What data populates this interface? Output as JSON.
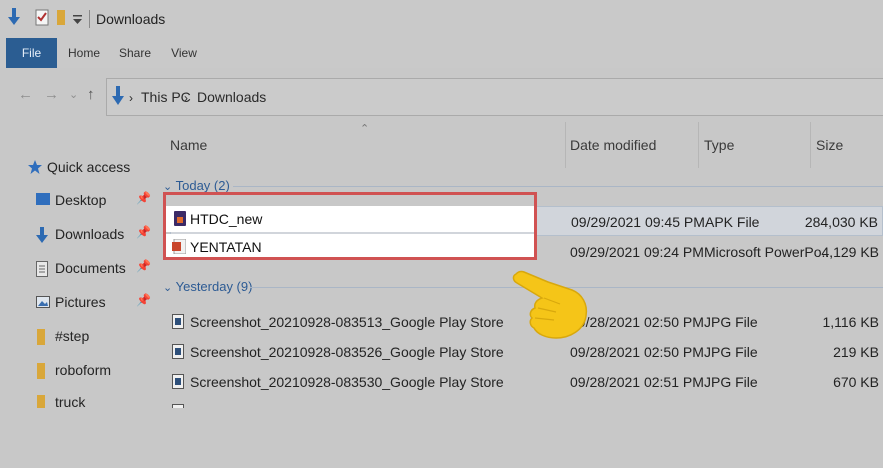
{
  "window": {
    "title": "Downloads"
  },
  "ribbon": {
    "tabs": [
      "File",
      "Home",
      "Share",
      "View"
    ]
  },
  "address": {
    "crumbs": [
      "This PC",
      "Downloads"
    ]
  },
  "sidebar": {
    "quick_access": "Quick access",
    "items": [
      {
        "label": "Desktop",
        "icon": "desktop-icon",
        "pinned": true
      },
      {
        "label": "Downloads",
        "icon": "download-arrow-icon",
        "pinned": true
      },
      {
        "label": "Documents",
        "icon": "documents-icon",
        "pinned": true
      },
      {
        "label": "Pictures",
        "icon": "pictures-icon",
        "pinned": true
      },
      {
        "label": "#step",
        "icon": "folder-icon",
        "pinned": false
      },
      {
        "label": "roboform",
        "icon": "folder-icon",
        "pinned": false
      },
      {
        "label": "truck",
        "icon": "folder-icon",
        "pinned": false
      }
    ]
  },
  "columns": {
    "name": "Name",
    "date": "Date modified",
    "type": "Type",
    "size": "Size"
  },
  "groups": {
    "today": {
      "label": "Today (2)",
      "files": [
        {
          "name": "HTDC_new",
          "date": "09/29/2021 09:45 PM",
          "type": "APK File",
          "size": "284,030 KB",
          "icon": "apk-file-icon"
        },
        {
          "name": "YENTATAN",
          "date": "09/29/2021 09:24 PM",
          "type": "Microsoft PowerPo...",
          "size": "4,129 KB",
          "icon": "powerpoint-file-icon"
        }
      ]
    },
    "yesterday": {
      "label": "Yesterday (9)",
      "files": [
        {
          "name": "Screenshot_20210928-083513_Google Play Store",
          "date": "09/28/2021 02:50 PM",
          "type": "JPG File",
          "size": "1,116 KB",
          "icon": "image-file-icon"
        },
        {
          "name": "Screenshot_20210928-083526_Google Play Store",
          "date": "09/28/2021 02:50 PM",
          "type": "JPG File",
          "size": "219 KB",
          "icon": "image-file-icon"
        },
        {
          "name": "Screenshot_20210928-083530_Google Play Store",
          "date": "09/28/2021 02:51 PM",
          "type": "JPG File",
          "size": "670 KB",
          "icon": "image-file-icon"
        }
      ]
    }
  },
  "colors": {
    "accent": "#2b5d92",
    "highlight_border": "#d05252",
    "hand": "#f5c518"
  }
}
